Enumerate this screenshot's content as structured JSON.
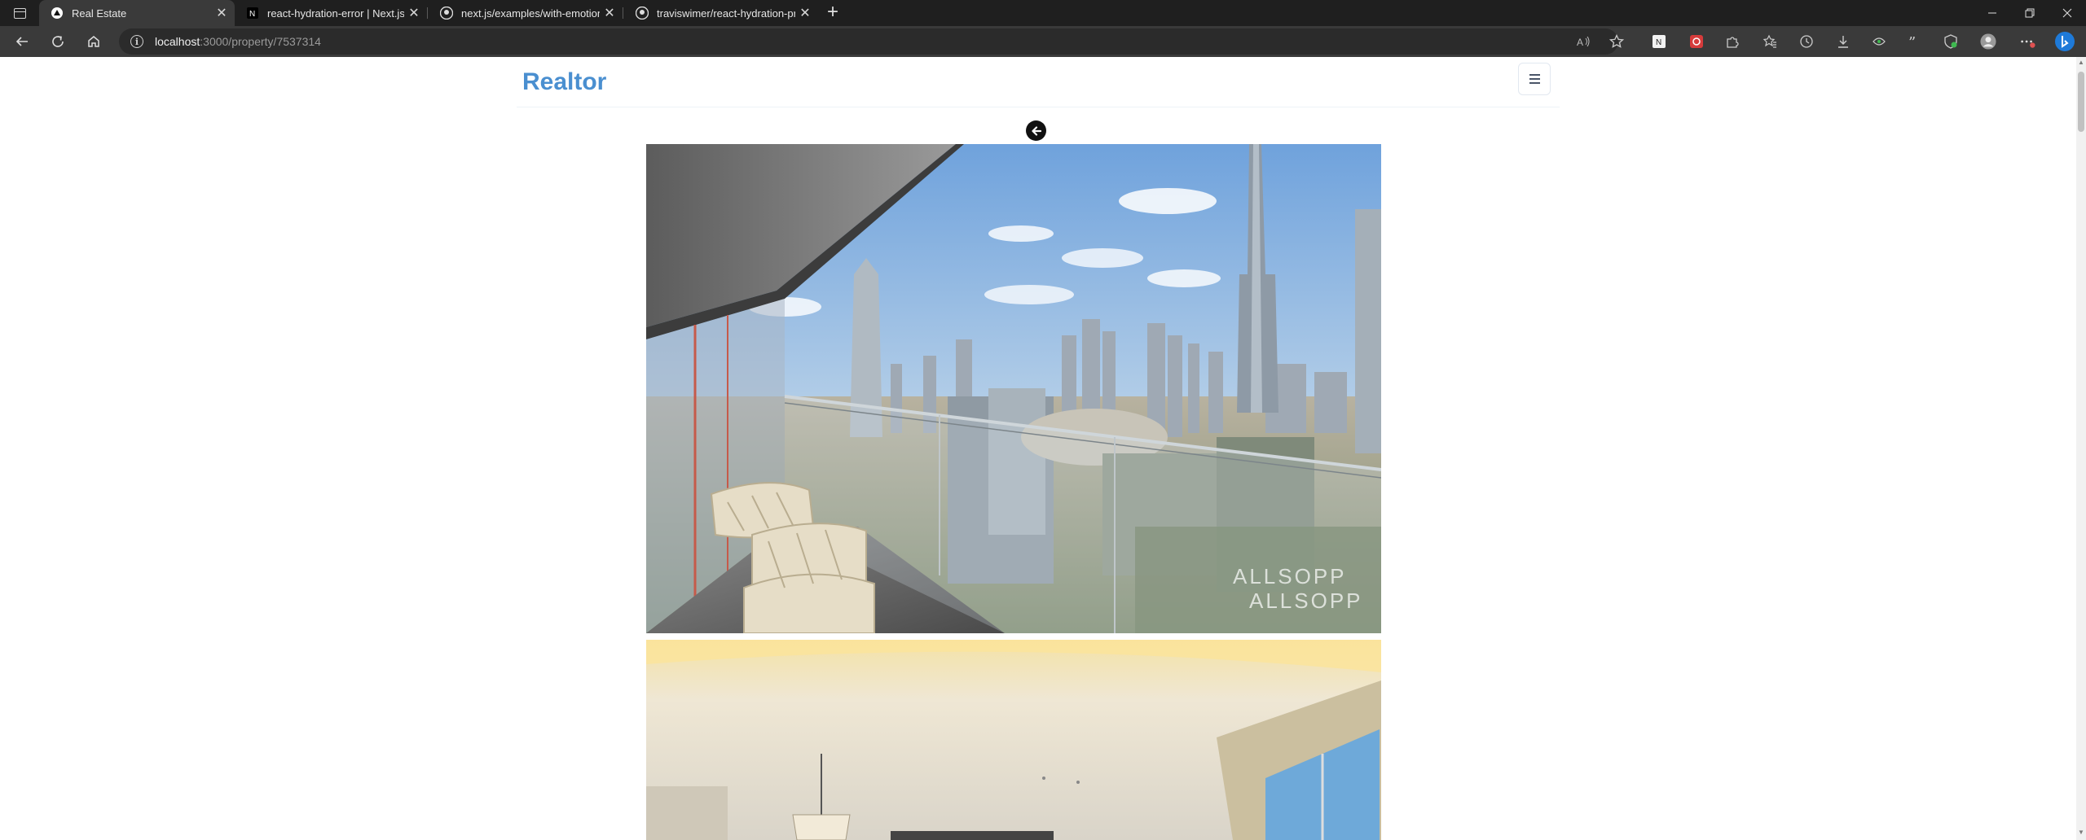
{
  "browser": {
    "tabs": [
      {
        "title": "Real Estate",
        "favicon": "nextjs-triangle-icon",
        "active": true
      },
      {
        "title": "react-hydration-error | Next.js",
        "favicon": "nextjs-icon",
        "active": false
      },
      {
        "title": "next.js/examples/with-emotion a",
        "favicon": "github-icon",
        "active": false
      },
      {
        "title": "traviswimer/react-hydration-pro",
        "favicon": "github-icon",
        "active": false
      }
    ],
    "new_tab_label": "+",
    "url": {
      "host": "localhost",
      "rest": ":3000/property/7537314"
    }
  },
  "page": {
    "logo": "Realtor",
    "photos": [
      {
        "alt": "Balcony view of Dubai skyline with Burj Khalifa",
        "watermark": "ALLSOPP ALLSOPP"
      },
      {
        "alt": "Interior living room with pendant lamp"
      }
    ]
  },
  "colors": {
    "brand": "#4a8fd0",
    "chrome_dark": "#1f1f1f",
    "chrome_mid": "#3a3a3a"
  }
}
